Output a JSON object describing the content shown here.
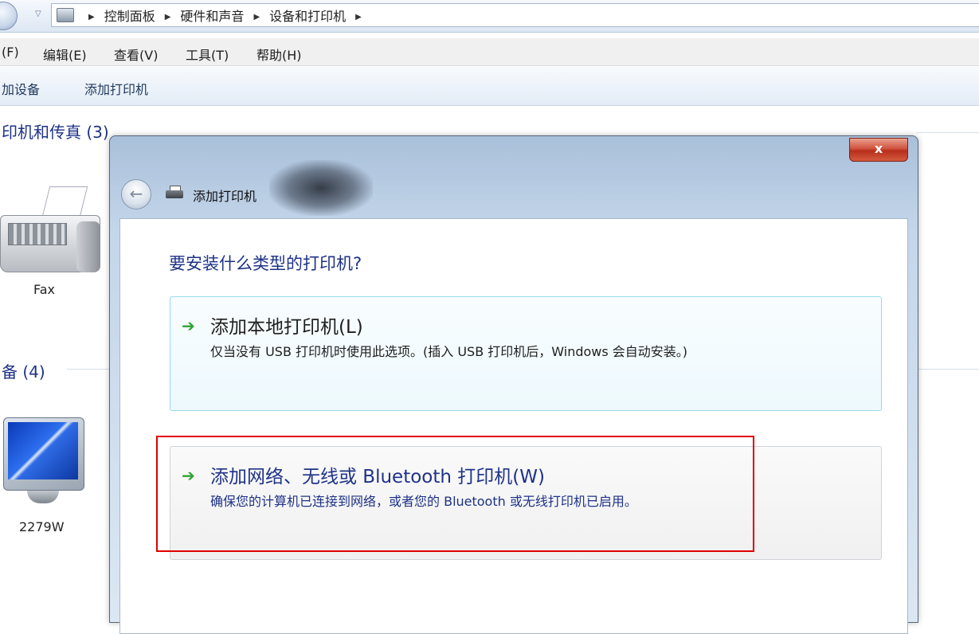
{
  "addressbar": {
    "breadcrumbs": [
      "控制面板",
      "硬件和声音",
      "设备和打印机"
    ]
  },
  "menubar": {
    "items": [
      "(F)",
      "编辑(E)",
      "查看(V)",
      "工具(T)",
      "帮助(H)"
    ]
  },
  "toolbar": {
    "add_device": "加设备",
    "add_printer": "添加打印机"
  },
  "background": {
    "group_printers": "印机和传真 (3)",
    "group_devices": "备 (4)",
    "fax_label": "Fax",
    "monitor_label": "2279W"
  },
  "dialog": {
    "title": "添加打印机",
    "close_label": "x",
    "question": "要安装什么类型的打印机?",
    "options": [
      {
        "title": "添加本地打印机(L)",
        "description": "仅当没有 USB 打印机时使用此选项。(插入 USB 打印机后，Windows 会自动安装。)"
      },
      {
        "title": "添加网络、无线或 Bluetooth 打印机(W)",
        "description": "确保您的计算机已连接到网络，或者您的 Bluetooth 或无线打印机已启用。"
      }
    ]
  },
  "colors": {
    "heading_blue": "#1e3287",
    "highlight_red": "#e00000",
    "arrow_green": "#2fa434"
  },
  "icons": [
    "back-icon",
    "printer-icon",
    "arrow-right-icon",
    "fax-icon",
    "monitor-icon",
    "close-icon"
  ]
}
